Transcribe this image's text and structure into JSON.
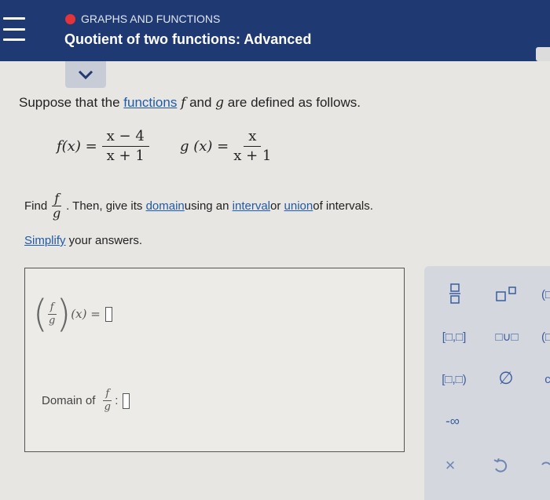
{
  "header": {
    "topic": "GRAPHS AND FUNCTIONS",
    "title": "Quotient of two functions: Advanced",
    "accent": "#1f3a73",
    "topic_dot_color": "#e3343a"
  },
  "problem": {
    "intro_prefix": "Suppose that the ",
    "intro_link": "functions",
    "intro_f": "f",
    "intro_mid": " and ",
    "intro_g": "g",
    "intro_suffix": " are defined as follows.",
    "f_lhs": "f(x) =",
    "f_num": "x − 4",
    "f_den": "x + 1",
    "g_lhs": "g (x) =",
    "g_num": "x",
    "g_den": "x + 1",
    "find_label": "Find",
    "find_num": "f",
    "find_den": "g",
    "find_text": ". Then, give its ",
    "link_domain": "domain",
    "using_text": " using an ",
    "link_interval": "interval",
    "or_text": " or ",
    "link_union": "union",
    "of_text": " of intervals.",
    "simplify_link": "Simplify",
    "simplify_text": " your answers."
  },
  "answer": {
    "expr_num": "f",
    "expr_den": "g",
    "expr_rest": "(x) =",
    "domain_label": "Domain of",
    "domain_num": "f",
    "domain_den": "g",
    "domain_colon": ":"
  },
  "keypad": {
    "icons": [
      "fraction-icon",
      "superscript-icon",
      "closed-interval-icon",
      "union-icon",
      "half-open-interval-icon",
      "empty-set-icon",
      "negative-infinity-icon",
      "clear-icon",
      "undo-icon"
    ],
    "closed_interval": "[□,□]",
    "union": "□∪□",
    "half_open": "[□,□)",
    "empty_set": "∅",
    "neg_inf": "-∞",
    "clear": "×",
    "partial_paren": "(□",
    "partial_paren2": "(□",
    "partial_c": "c"
  }
}
